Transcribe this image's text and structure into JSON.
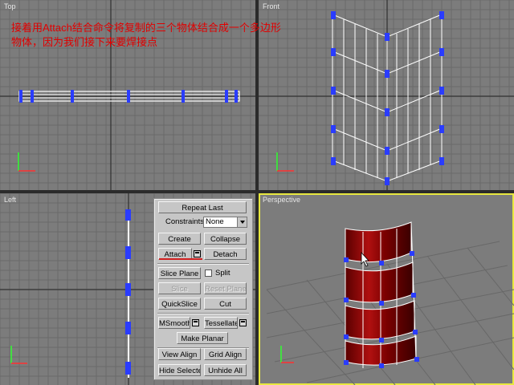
{
  "caption": {
    "line1": "接着用Attach结合命令将复制的三个物体结合成一个多边形",
    "line2": "物体，因为我们接下来要焊接点"
  },
  "viewports": {
    "top": "Top",
    "front": "Front",
    "left": "Left",
    "perspective": "Perspective"
  },
  "panel": {
    "repeat_last": "Repeat Last",
    "constraints_label": "Constraints:",
    "constraints_value": "None",
    "create": "Create",
    "collapse": "Collapse",
    "attach": "Attach",
    "detach": "Detach",
    "slice_plane": "Slice Plane",
    "split": "Split",
    "slice": "Slice",
    "reset_plane": "Reset Plane",
    "quickslice": "QuickSlice",
    "cut": "Cut",
    "msmooth": "MSmooth",
    "tessellate": "Tessellate",
    "make_planar": "Make Planar",
    "view_align": "View Align",
    "grid_align": "Grid Align",
    "hide_selected": "Hide Selected",
    "unhide_all": "Unhide All"
  },
  "colors": {
    "viewport_bg": "#7c7c7c",
    "grid": "#6a6a6a",
    "grid_major": "#303030",
    "wire": "#ffffff",
    "vertex": "#2a3cff",
    "active_border": "#e8e840",
    "caption": "#e10000",
    "panel_bg": "#c6c6c6"
  }
}
